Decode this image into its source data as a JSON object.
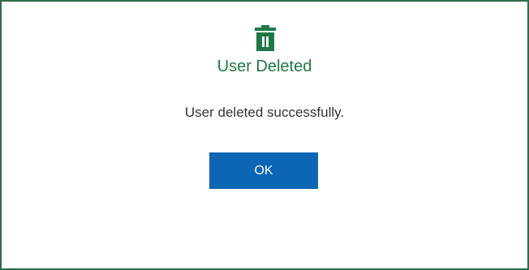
{
  "dialog": {
    "icon": "trash-icon",
    "title": "User Deleted",
    "message": "User deleted successfully.",
    "ok_label": "OK"
  },
  "colors": {
    "border": "#2e6b4a",
    "accent": "#1e7845",
    "button": "#0b66b3",
    "button_text": "#ffffff",
    "message_text": "#333333"
  }
}
